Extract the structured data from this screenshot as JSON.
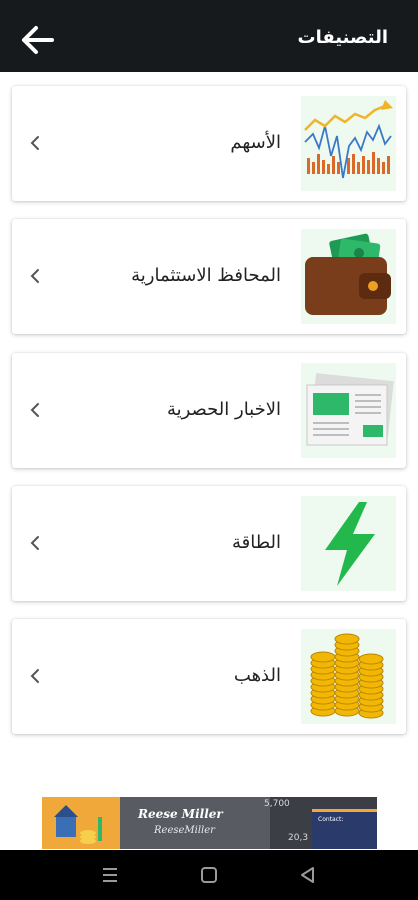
{
  "header": {
    "title": "التصنيفات",
    "back_icon": "arrow-left-icon"
  },
  "categories": [
    {
      "label": "الأسهم",
      "icon": "stock-chart-icon"
    },
    {
      "label": "المحافظ الاستثمارية",
      "icon": "wallet-icon"
    },
    {
      "label": "الاخبار الحصرية",
      "icon": "newspaper-icon"
    },
    {
      "label": "الطاقة",
      "icon": "lightning-icon"
    },
    {
      "label": "الذهب",
      "icon": "gold-coins-icon"
    }
  ],
  "ad": {
    "name": "Reese Miller",
    "signature": "ReeseMiller",
    "number_top": "5,700",
    "number_bottom": "20,3",
    "contact_label": "Contact:"
  },
  "colors": {
    "app_bar": "#171a1d",
    "thumb_bg": "#eefaf0",
    "accent_green": "#22b84c"
  },
  "nav": [
    "menu-icon",
    "home-square-icon",
    "back-triangle-icon"
  ]
}
